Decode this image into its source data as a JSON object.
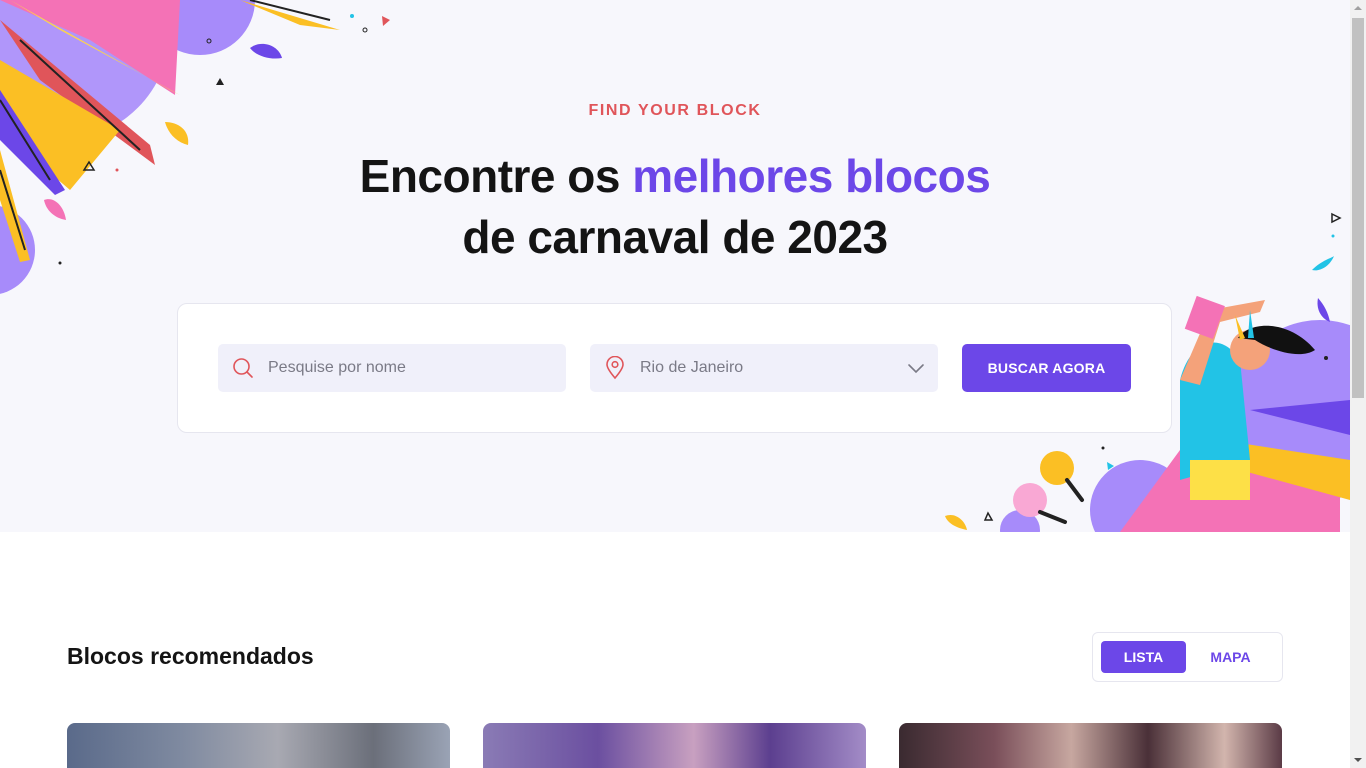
{
  "hero": {
    "eyebrow": "FIND YOUR BLOCK",
    "headline_part1": "Encontre os ",
    "headline_accent": "melhores blocos",
    "headline_part2": "de carnaval de 2023"
  },
  "search": {
    "name_placeholder": "Pesquise por nome",
    "city_value": "Rio de Janeiro",
    "button_label": "BUSCAR AGORA"
  },
  "recommended": {
    "title": "Blocos recomendados",
    "view_toggle": {
      "list_label": "LISTA",
      "map_label": "MAPA",
      "selected": "LISTA"
    }
  },
  "icons": {
    "search": "search-icon",
    "location": "map-pin-icon",
    "dropdown": "chevron-down-icon"
  },
  "colors": {
    "accent": "#6c47e8",
    "eyebrow": "#e0555a",
    "hero_bg": "#f7f7fc",
    "field_bg": "#f0f0fa"
  }
}
